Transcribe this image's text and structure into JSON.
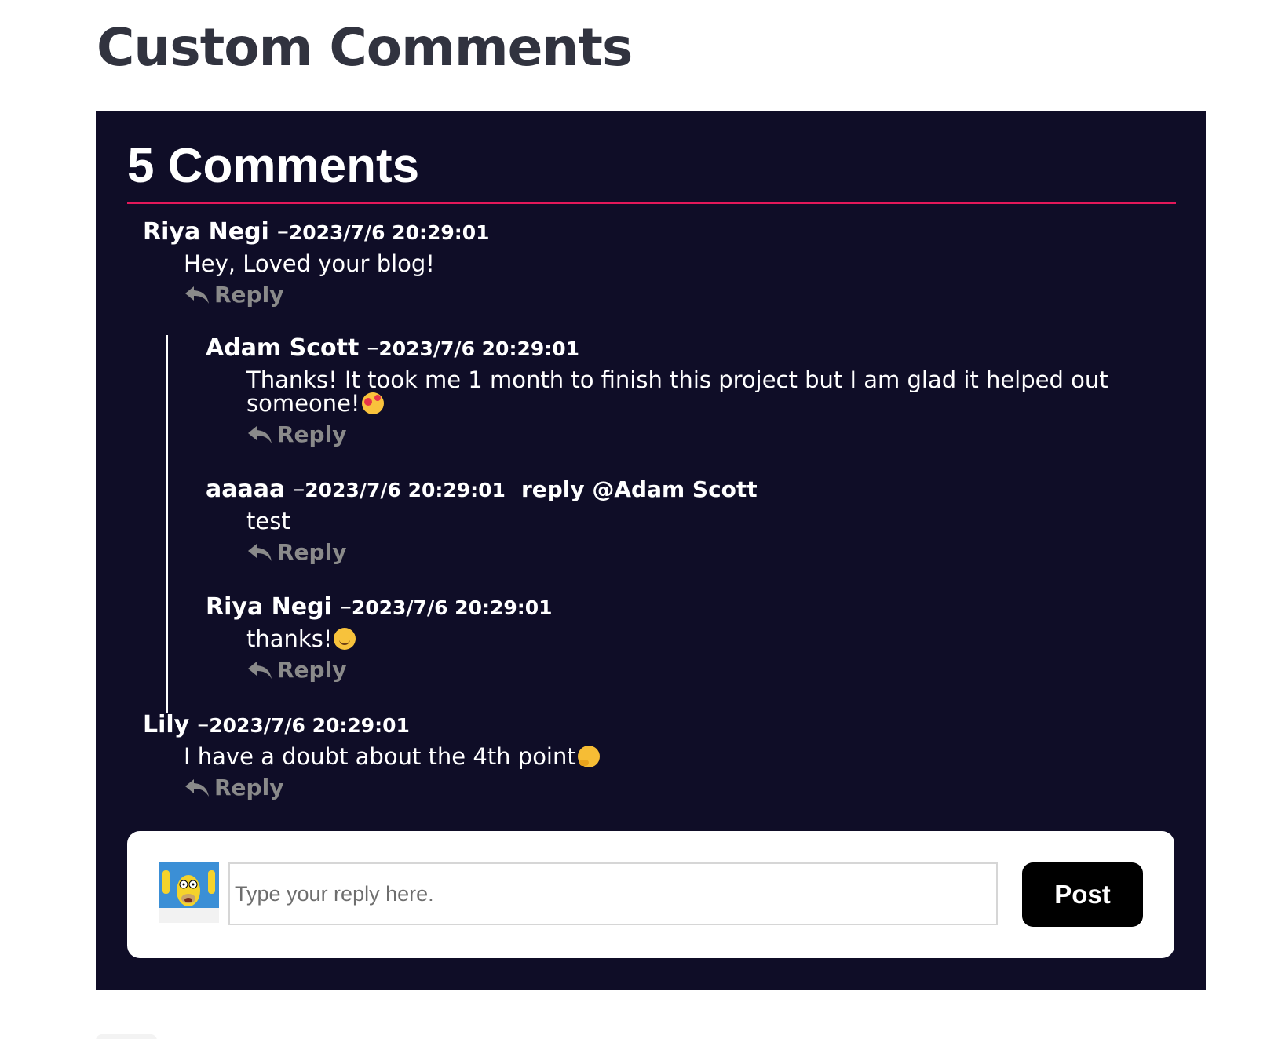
{
  "page": {
    "title": "Custom Comments"
  },
  "comments_section": {
    "heading": "5 Comments",
    "dash": "–",
    "reply_label": "Reply",
    "comments": [
      {
        "author": "Riya Negi",
        "date": "2023/7/6 20:29:01",
        "text": "Hey, Loved your blog!"
      },
      {
        "author": "Adam Scott",
        "date": "2023/7/6 20:29:01",
        "text_line1": "Thanks! It took me 1 month to finish this project but I am glad it helped out",
        "text_line2": "someone!",
        "emoji": "smiling-face-with-hearts-emoji"
      },
      {
        "author": "aaaaa",
        "date": "2023/7/6 20:29:01",
        "reply_to": "reply @Adam Scott",
        "text": "test"
      },
      {
        "author": "Riya Negi",
        "date": "2023/7/6 20:29:01",
        "text": "thanks!",
        "emoji": "smiling-face-emoji"
      },
      {
        "author": "Lily",
        "date": "2023/7/6 20:29:01",
        "text": "I have a doubt about the 4th point",
        "emoji": "thinking-face-emoji"
      }
    ]
  },
  "composer": {
    "avatar": "homer-avatar",
    "placeholder": "Type your reply here.",
    "value": "",
    "post_label": "Post"
  },
  "colors": {
    "page_background": "#ffffff",
    "title_text": "#31333f",
    "panel_background": "#0f0d27",
    "divider": "#e3185a",
    "comment_text": "#ffffff",
    "reply_link": "#8a8a8a",
    "post_button": "#000000"
  }
}
